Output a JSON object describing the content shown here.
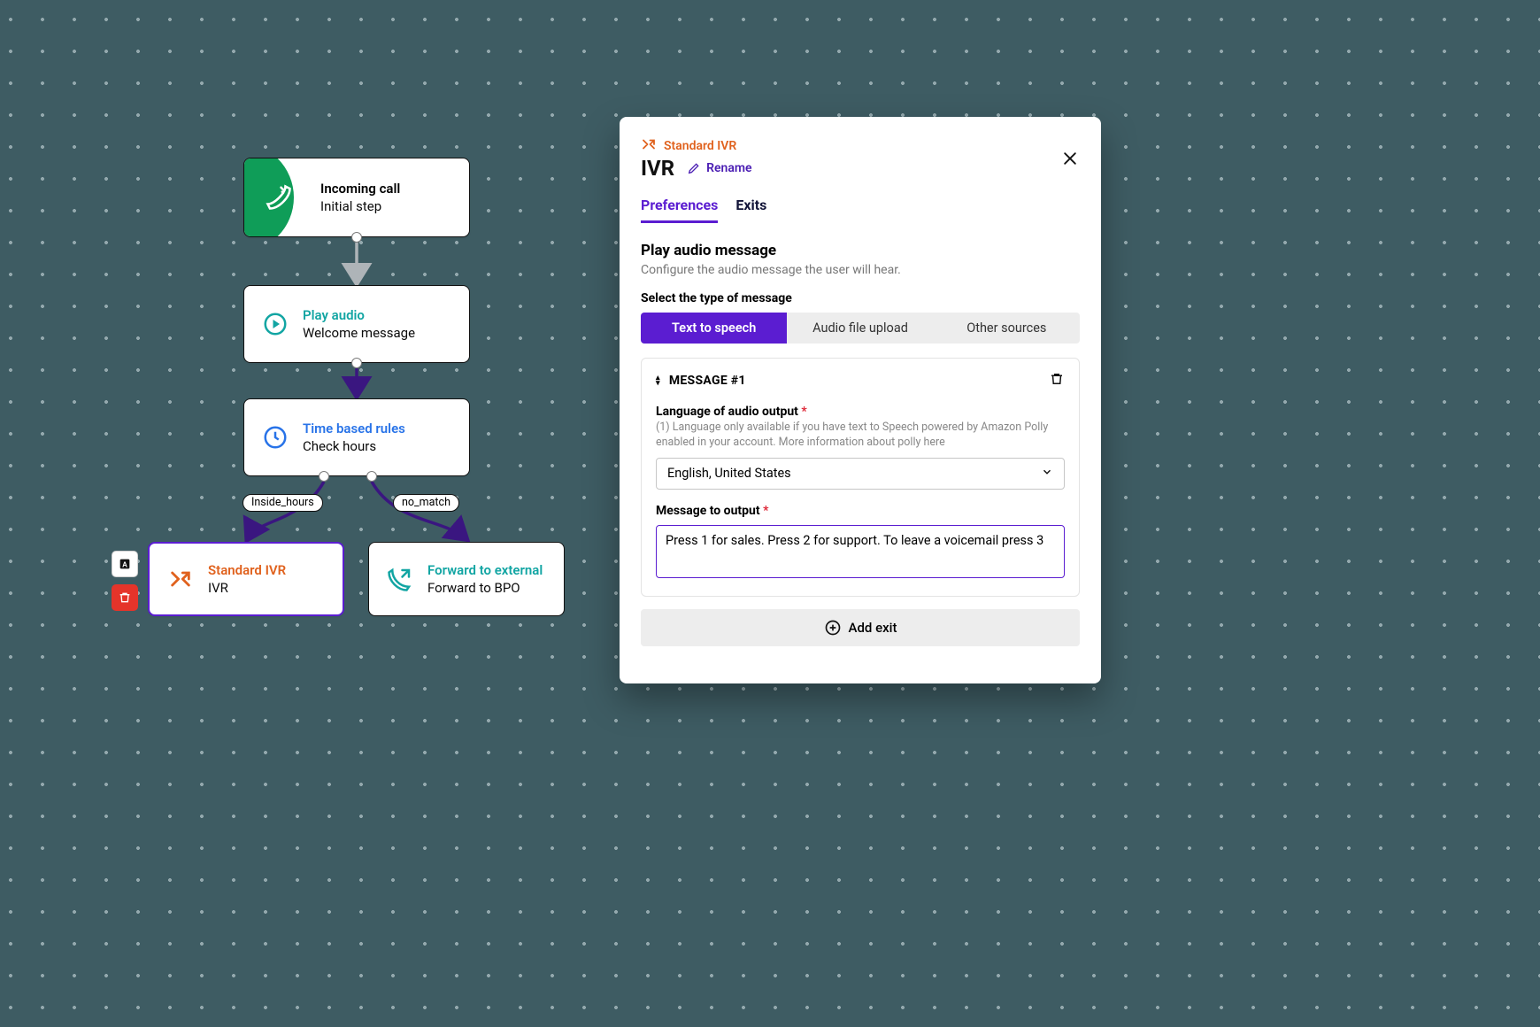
{
  "flow": {
    "incoming": {
      "type": "Incoming call",
      "name": "Initial step"
    },
    "play": {
      "type": "Play audio",
      "name": "Welcome message"
    },
    "time": {
      "type": "Time based rules",
      "name": "Check hours"
    },
    "ivr": {
      "type": "Standard IVR",
      "name": "IVR"
    },
    "fwd": {
      "type": "Forward to external",
      "name": "Forward to BPO"
    },
    "edgeLabels": {
      "inside": "Inside_hours",
      "nomatch": "no_match"
    }
  },
  "panel": {
    "breadcrumb": "Standard IVR",
    "title": "IVR",
    "rename": "Rename",
    "tabs": {
      "preferences": "Preferences",
      "exits": "Exits"
    },
    "section": {
      "heading": "Play audio message",
      "sub": "Configure the audio message the user will hear."
    },
    "typeLabel": "Select the type of message",
    "typeOptions": {
      "tts": "Text to speech",
      "upload": "Audio file upload",
      "other": "Other sources"
    },
    "message": {
      "header": "MESSAGE #1",
      "langLabel": "Language of audio output",
      "langHint": "(1) Language only available if you have text to Speech powered by Amazon Polly enabled in your account. More information about polly here",
      "langValue": "English, United States",
      "outLabel": "Message to output",
      "outValue": "Press 1 for sales. Press 2 for support. To leave a voicemail press 3"
    },
    "addExit": "Add exit"
  }
}
